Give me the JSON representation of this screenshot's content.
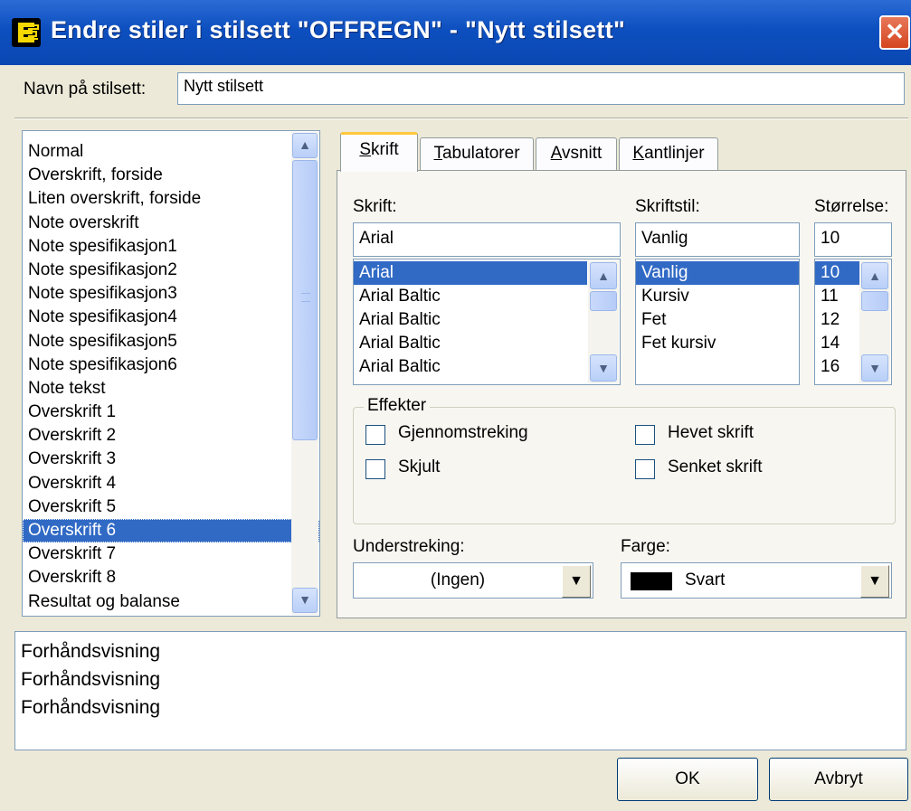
{
  "window": {
    "title": "Endre stiler i stilsett \"OFFREGN\" - \"Nytt stilsett\"",
    "close_symbol": "✕"
  },
  "name_field": {
    "label": "Navn på stilsett:",
    "value": "Nytt stilsett"
  },
  "style_list": {
    "items": [
      "Normal",
      "Overskrift, forside",
      "Liten overskrift, forside",
      "Note overskrift",
      "Note spesifikasjon1",
      "Note spesifikasjon2",
      "Note spesifikasjon3",
      "Note spesifikasjon4",
      "Note spesifikasjon5",
      "Note spesifikasjon6",
      "Note tekst",
      "Overskrift 1",
      "Overskrift 2",
      "Overskrift 3",
      "Overskrift 4",
      "Overskrift 5",
      "Overskrift 6",
      "Overskrift 7",
      "Overskrift 8",
      "Resultat og balanse"
    ],
    "selected": "Overskrift 6"
  },
  "tabs": [
    {
      "key": "S",
      "rest": "krift"
    },
    {
      "key": "T",
      "rest": "abulatorer"
    },
    {
      "key": "A",
      "rest": "vsnitt"
    },
    {
      "key": "K",
      "rest": "antlinjer"
    }
  ],
  "font": {
    "font_label": "Skrift:",
    "font_value": "Arial",
    "font_options": [
      "Arial",
      "Arial Baltic",
      "Arial Baltic",
      "Arial Baltic",
      "Arial Baltic"
    ],
    "style_label": "Skriftstil:",
    "style_value": "Vanlig",
    "style_options": [
      "Vanlig",
      "Kursiv",
      "Fet",
      "Fet kursiv"
    ],
    "size_label": "Størrelse:",
    "size_value": "10",
    "size_options": [
      "10",
      "11",
      "12",
      "14",
      "16"
    ]
  },
  "effects": {
    "title": "Effekter",
    "strikethrough": "Gjennomstreking",
    "hidden": "Skjult",
    "superscript": "Hevet skrift",
    "subscript": "Senket skrift"
  },
  "underline": {
    "label": "Understreking:",
    "value": "(Ingen)"
  },
  "color": {
    "label": "Farge:",
    "value": "Svart",
    "swatch": "#000000"
  },
  "preview": [
    "Forhåndsvisning",
    "Forhåndsvisning",
    "Forhåndsvisning"
  ],
  "buttons": {
    "ok": "OK",
    "cancel": "Avbryt"
  }
}
